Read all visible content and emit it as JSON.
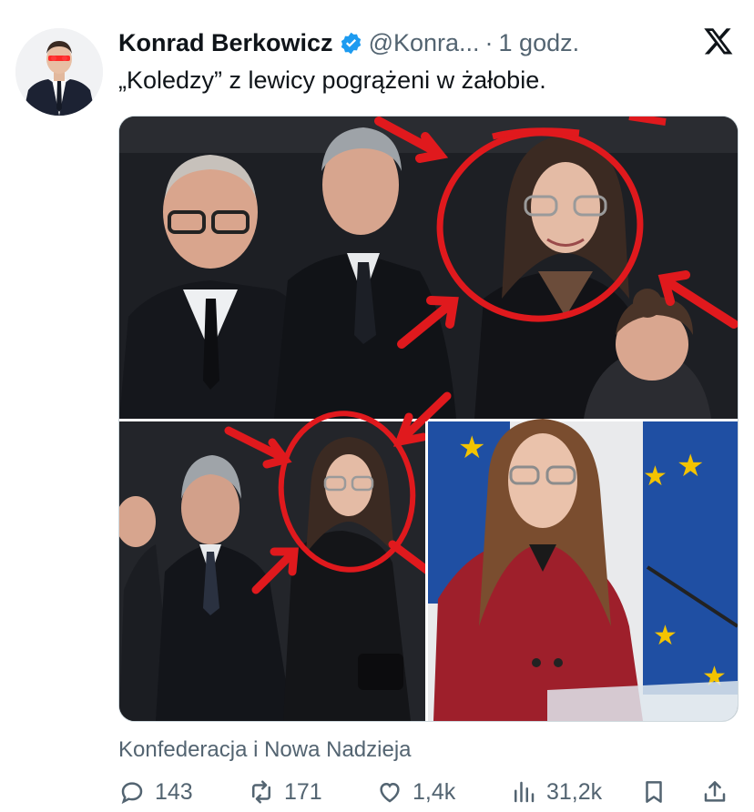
{
  "author": {
    "display_name": "Konrad Berkowicz",
    "handle": "@Konra...",
    "separator": "·",
    "time": "1 godz.",
    "verified": true
  },
  "tweet": {
    "text": "„Koledzy” z lewicy pogrążeni w żałobie."
  },
  "media": {
    "panels": [
      "top-photo",
      "bottom-left-photo",
      "bottom-right-photo"
    ]
  },
  "source_label": "Konfederacja i Nowa Nadzieja",
  "actions": {
    "replies": "143",
    "reposts": "171",
    "likes": "1,4k",
    "views": "31,2k"
  },
  "icons": {
    "verified": "verified-badge-icon",
    "platform": "x-logo-icon",
    "reply": "reply-icon",
    "repost": "repost-icon",
    "like": "heart-icon",
    "views": "views-icon",
    "bookmark": "bookmark-icon",
    "share": "share-icon"
  },
  "colors": {
    "text_primary": "#0f1419",
    "text_secondary": "#536471",
    "verified_blue": "#1d9bf0",
    "annotation_red": "#e0191d",
    "eu_blue": "#1f4fa3",
    "eu_star": "#f3c300"
  }
}
